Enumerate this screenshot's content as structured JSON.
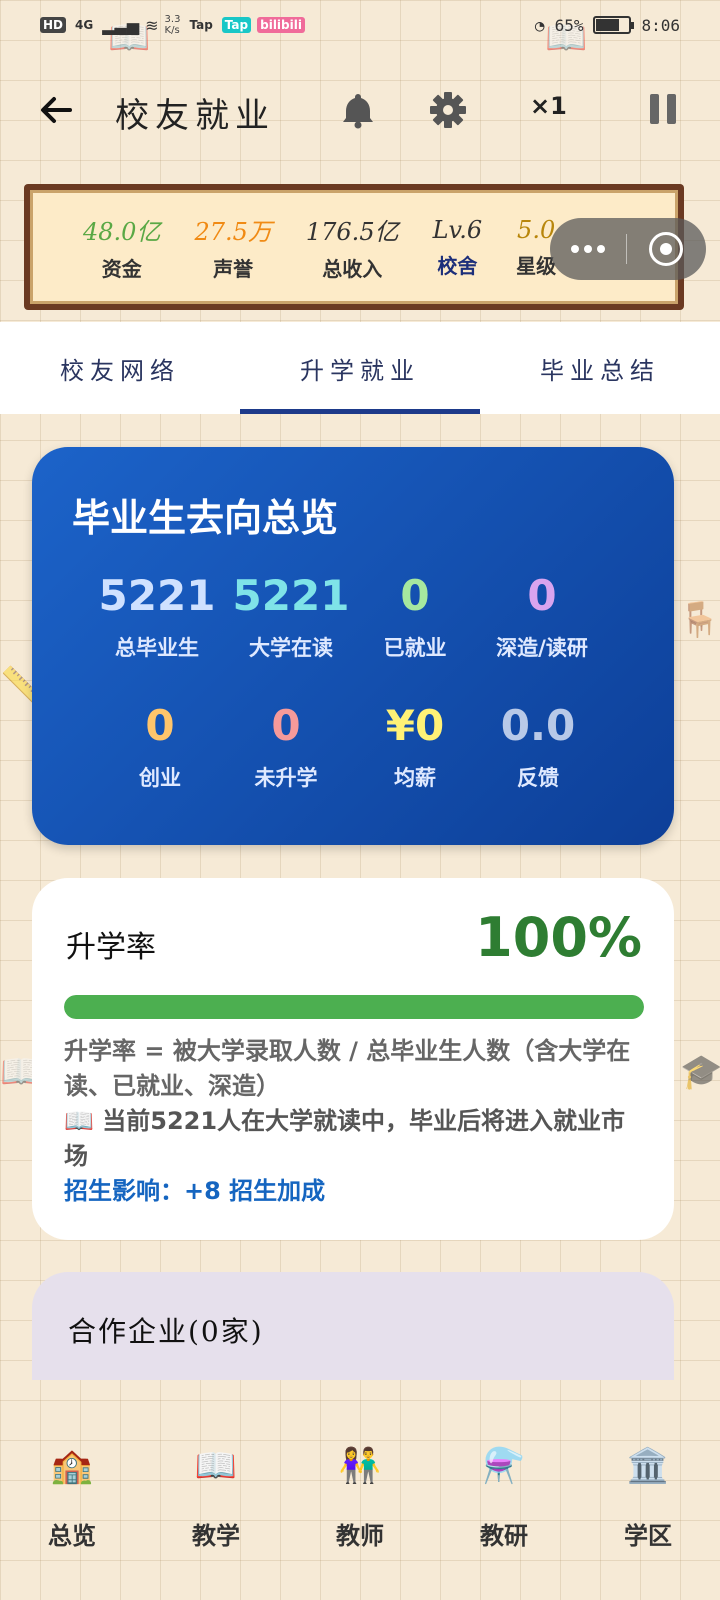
{
  "status_bar": {
    "left_tags": [
      "HD",
      "Tap",
      "Tap",
      "bilibili"
    ],
    "signal_label": "4G",
    "speed_value": "3.3",
    "speed_unit": "K/s",
    "battery_percent": "65%",
    "time": "8:06"
  },
  "header": {
    "title": "校友就业",
    "speed_label": "×1"
  },
  "resources": [
    {
      "value": "48.0亿",
      "label": "资金",
      "color": "#5aa845"
    },
    {
      "value": "27.5万",
      "label": "声誉",
      "color": "#f08a14"
    },
    {
      "value": "176.5亿",
      "label": "总收入",
      "color": "#333333"
    },
    {
      "value": "Lv.6",
      "label": "校舍",
      "color": "#333333"
    },
    {
      "value": "5.0",
      "label": "星级",
      "color": "#b8860b"
    }
  ],
  "tabs": [
    {
      "label": "校友网络"
    },
    {
      "label": "升学就业"
    },
    {
      "label": "毕业总结"
    }
  ],
  "overview": {
    "title": "毕业生去向总览",
    "stats": [
      {
        "value": "5221",
        "label": "总毕业生",
        "color": "#cfe1ff"
      },
      {
        "value": "5221",
        "label": "大学在读",
        "color": "#7fe3e8"
      },
      {
        "value": "0",
        "label": "已就业",
        "color": "#a6e89f"
      },
      {
        "value": "0",
        "label": "深造/读研",
        "color": "#d9a4ef"
      },
      {
        "value": "0",
        "label": "创业",
        "color": "#ffc56b"
      },
      {
        "value": "0",
        "label": "未升学",
        "color": "#f59a9a"
      },
      {
        "value": "¥0",
        "label": "均薪",
        "color": "#fff176"
      },
      {
        "value": "0.0",
        "label": "反馈",
        "color": "#b8c9e8"
      }
    ]
  },
  "rate_card": {
    "title": "升学率",
    "value": "100%",
    "progress": 1.0,
    "formula": "升学率 = 被大学录取人数 / 总毕业生人数（含大学在读、已就业、深造）",
    "note_icon": "📖",
    "note": "当前5221人在大学就读中，毕业后将进入就业市场",
    "bonus": "招生影响：+8 招生加成"
  },
  "partners": {
    "title": "合作企业(0家)"
  },
  "bottom_nav": [
    {
      "label": "总览",
      "icon": "🏫"
    },
    {
      "label": "教学",
      "icon": "📖"
    },
    {
      "label": "教师",
      "icon": "👫"
    },
    {
      "label": "教研",
      "icon": "⚗️"
    },
    {
      "label": "学区",
      "icon": "🏛️"
    }
  ]
}
